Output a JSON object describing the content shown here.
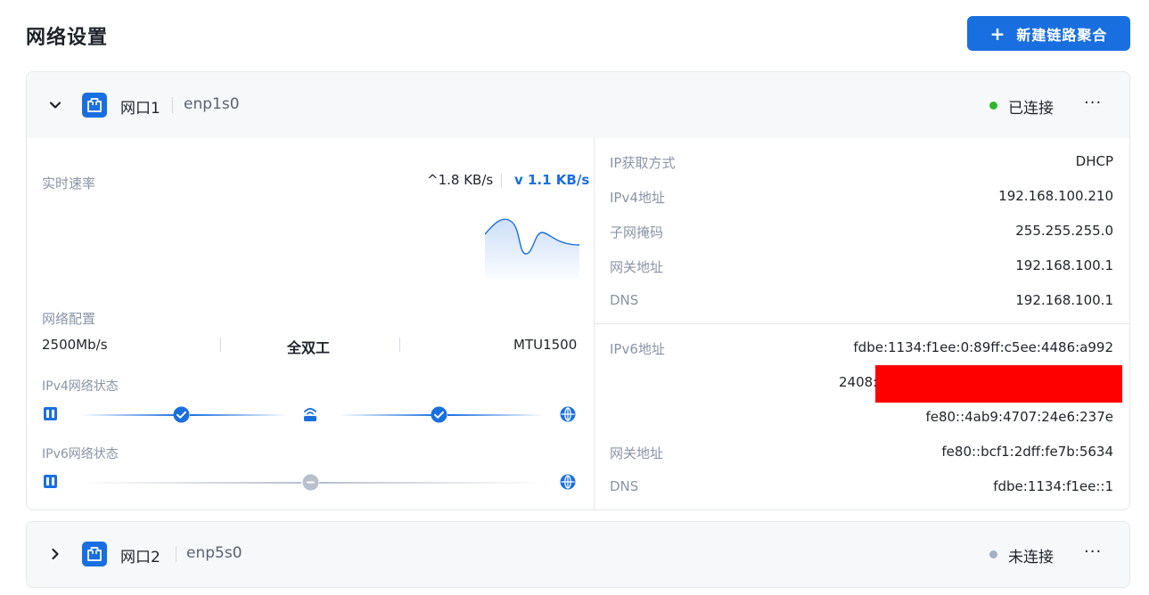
{
  "page": {
    "title": "网络设置",
    "new_bond_label": "新建链路聚合",
    "new_bond_icon": "plus-icon"
  },
  "colors": {
    "accent": "#1a6fe0",
    "connected": "#2eb82e",
    "disconnected": "#a3b1c6",
    "redaction": "#ff0000"
  },
  "ports": [
    {
      "name": "网口1",
      "interface": "enp1s0",
      "status": "已连接",
      "expanded": true,
      "more_label": "···",
      "realtime": {
        "label": "实时速率",
        "upload": "^1.8 KB/s",
        "download": "v 1.1 KB/s"
      },
      "config": {
        "label": "网络配置",
        "speed": "2500Mb/s",
        "duplex": "全双工",
        "mtu": "MTU1500"
      },
      "ipv4_status": {
        "label": "IPv4网络状态",
        "segments": [
          "ok",
          "ok"
        ]
      },
      "ipv6_status": {
        "label": "IPv6网络状态",
        "segments": [
          "pending"
        ]
      },
      "ipv4": [
        {
          "label": "IP获取方式",
          "value": "DHCP"
        },
        {
          "label": "IPv4地址",
          "value": "192.168.100.210"
        },
        {
          "label": "子网掩码",
          "value": "255.255.255.0"
        },
        {
          "label": "网关地址",
          "value": "192.168.100.1"
        },
        {
          "label": "DNS",
          "value": "192.168.100.1"
        }
      ],
      "ipv6": {
        "address_label": "IPv6地址",
        "addresses": [
          "fdbe:1134:f1ee:0:89ff:c5ee:4486:a992",
          "2408:",
          "fe80::4ab9:4707:24e6:237e"
        ],
        "gateway_label": "网关地址",
        "gateway": "fe80::bcf1:2dff:fe7b:5634",
        "dns_label": "DNS",
        "dns": "fdbe:1134:f1ee::1"
      }
    },
    {
      "name": "网口2",
      "interface": "enp5s0",
      "status": "未连接",
      "expanded": false,
      "more_label": "···"
    }
  ]
}
